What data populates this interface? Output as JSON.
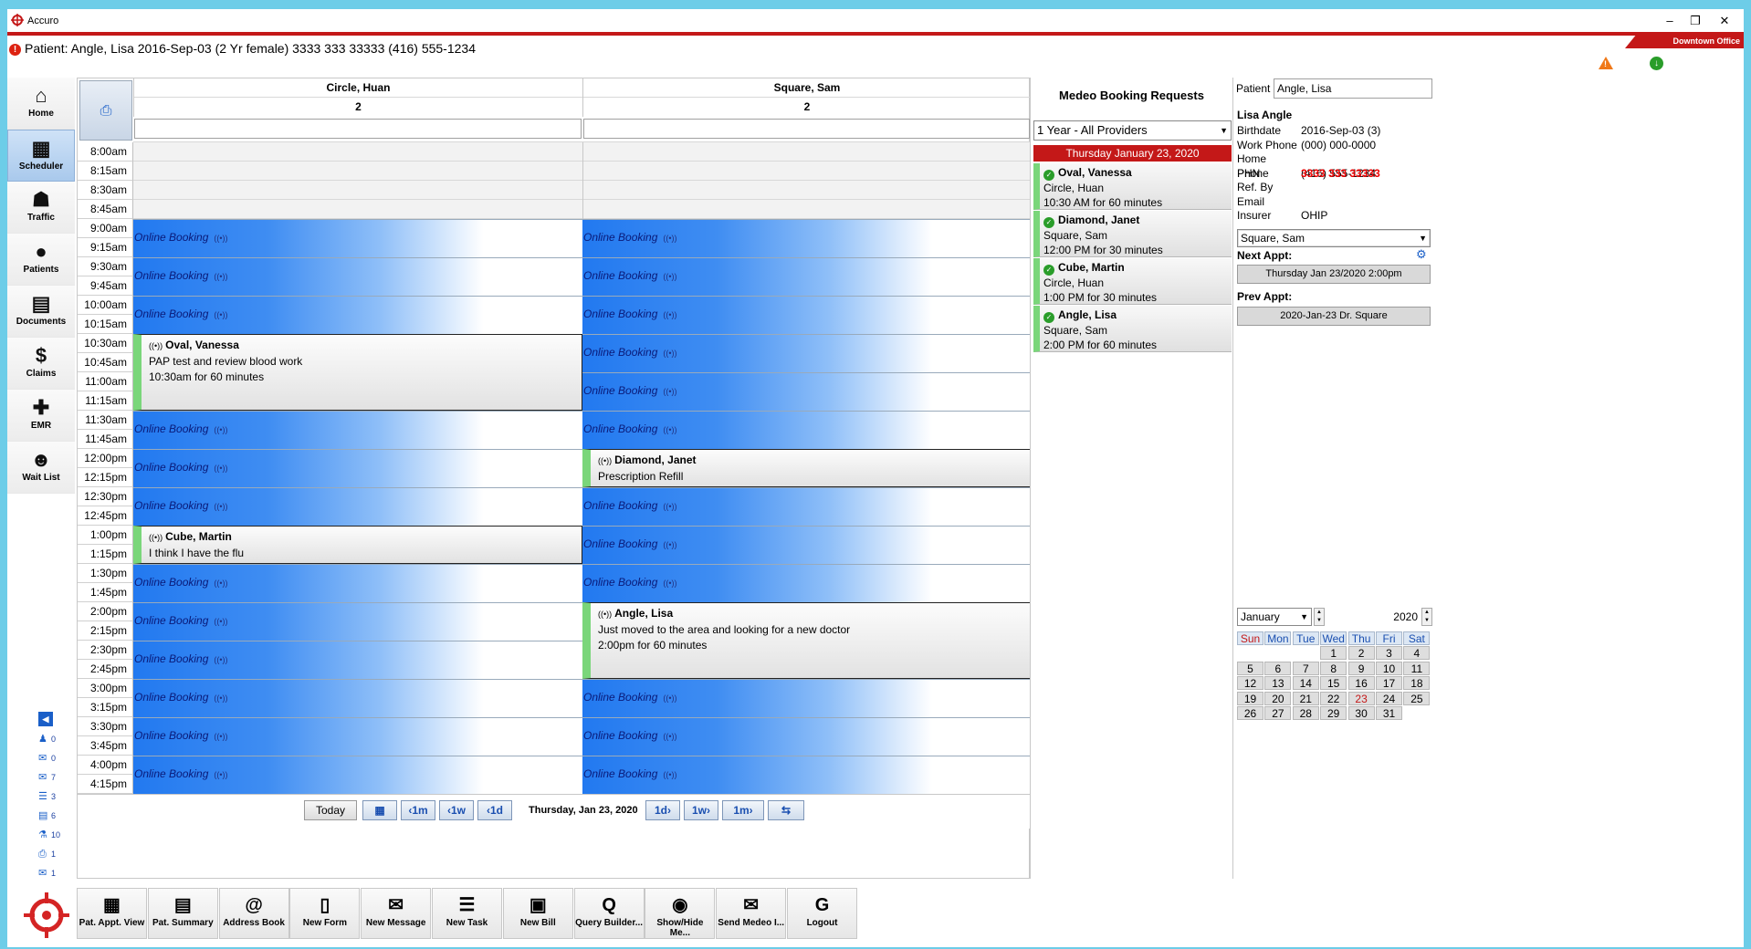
{
  "app": {
    "title": "Accuro",
    "office": "Downtown Office",
    "patient_banner": "Patient: Angle, Lisa 2016-Sep-03 (2 Yr female) 3333 333 33333 (416) 555-1234"
  },
  "nav": [
    {
      "label": "Home",
      "icon": "house-icon",
      "glyph": "⌂"
    },
    {
      "label": "Scheduler",
      "icon": "calendar-icon",
      "glyph": "▦",
      "active": true
    },
    {
      "label": "Traffic",
      "icon": "org-chart-icon",
      "glyph": "☗"
    },
    {
      "label": "Patients",
      "icon": "person-icon",
      "glyph": "●"
    },
    {
      "label": "Documents",
      "icon": "document-icon",
      "glyph": "▤"
    },
    {
      "label": "Claims",
      "icon": "dollar-icon",
      "glyph": "$"
    },
    {
      "label": "EMR",
      "icon": "medical-bag-icon",
      "glyph": "✚"
    },
    {
      "label": "Wait List",
      "icon": "people-icon",
      "glyph": "☻"
    }
  ],
  "counts": [
    {
      "icon": "user-icon",
      "glyph": "♟",
      "value": "0"
    },
    {
      "icon": "inbox-icon",
      "glyph": "✉",
      "value": "0"
    },
    {
      "icon": "mail-icon",
      "glyph": "✉",
      "value": "7"
    },
    {
      "icon": "list-icon",
      "glyph": "☰",
      "value": "3"
    },
    {
      "icon": "page-icon",
      "glyph": "▤",
      "value": "6"
    },
    {
      "icon": "lab-icon",
      "glyph": "⚗",
      "value": "10"
    },
    {
      "icon": "printer-icon",
      "glyph": "⎙",
      "value": "1"
    },
    {
      "icon": "fax-icon",
      "glyph": "✉",
      "value": "1"
    }
  ],
  "scheduler": {
    "columns": [
      {
        "name": "Circle, Huan",
        "count": "2"
      },
      {
        "name": "Square, Sam",
        "count": "2"
      }
    ],
    "times": [
      "8:00am",
      "8:15am",
      "8:30am",
      "8:45am",
      "9:00am",
      "9:15am",
      "9:30am",
      "9:45am",
      "10:00am",
      "10:15am",
      "10:30am",
      "10:45am",
      "11:00am",
      "11:15am",
      "11:30am",
      "11:45am",
      "12:00pm",
      "12:15pm",
      "12:30pm",
      "12:45pm",
      "1:00pm",
      "1:15pm",
      "1:30pm",
      "1:45pm",
      "2:00pm",
      "2:15pm",
      "2:30pm",
      "2:45pm",
      "3:00pm",
      "3:15pm",
      "3:30pm",
      "3:45pm",
      "4:00pm",
      "4:15pm"
    ],
    "online_label": "Online Booking",
    "online_slots": [
      {
        "col": 0,
        "row": 4
      },
      {
        "col": 0,
        "row": 6
      },
      {
        "col": 0,
        "row": 8
      },
      {
        "col": 0,
        "row": 14
      },
      {
        "col": 0,
        "row": 16
      },
      {
        "col": 0,
        "row": 18
      },
      {
        "col": 0,
        "row": 22
      },
      {
        "col": 0,
        "row": 24
      },
      {
        "col": 0,
        "row": 26
      },
      {
        "col": 0,
        "row": 28
      },
      {
        "col": 0,
        "row": 30
      },
      {
        "col": 0,
        "row": 32
      },
      {
        "col": 1,
        "row": 4
      },
      {
        "col": 1,
        "row": 6
      },
      {
        "col": 1,
        "row": 8
      },
      {
        "col": 1,
        "row": 10
      },
      {
        "col": 1,
        "row": 12
      },
      {
        "col": 1,
        "row": 14
      },
      {
        "col": 1,
        "row": 18
      },
      {
        "col": 1,
        "row": 20
      },
      {
        "col": 1,
        "row": 22
      },
      {
        "col": 1,
        "row": 28
      },
      {
        "col": 1,
        "row": 30
      },
      {
        "col": 1,
        "row": 32
      }
    ],
    "appointments": [
      {
        "col": 0,
        "row": 10,
        "rows": 4,
        "name": "Oval, Vanessa",
        "line1": "PAP test and review blood work",
        "line2": "10:30am for 60 minutes"
      },
      {
        "col": 1,
        "row": 16,
        "rows": 2,
        "name": "Diamond, Janet",
        "line1": "Prescription Refill",
        "line2": ""
      },
      {
        "col": 0,
        "row": 20,
        "rows": 2,
        "name": "Cube, Martin",
        "line1": "I think I have the flu",
        "line2": ""
      },
      {
        "col": 1,
        "row": 24,
        "rows": 4,
        "name": "Angle, Lisa",
        "line1": "Just moved to the area and looking for a new doctor",
        "line2": "2:00pm for 60 minutes"
      }
    ],
    "date_nav": {
      "today": "Today",
      "back_month": "‹1m",
      "back_week": "‹1w",
      "back_day": "‹1d",
      "current_date": "Thursday, Jan 23, 2020",
      "fwd_day": "1d›",
      "fwd_week": "1w›",
      "fwd_month": "1m›"
    }
  },
  "toolbar": [
    {
      "label": "Pat. Appt. View",
      "icon": "calendar-icon",
      "glyph": "▦"
    },
    {
      "label": "Pat. Summary",
      "icon": "clipboard-icon",
      "glyph": "▤"
    },
    {
      "label": "Address Book",
      "icon": "address-book-icon",
      "glyph": "@"
    },
    {
      "label": "New Form",
      "icon": "form-icon",
      "glyph": "▯"
    },
    {
      "label": "New Message",
      "icon": "envelope-icon",
      "glyph": "✉"
    },
    {
      "label": "New Task",
      "icon": "task-list-icon",
      "glyph": "☰"
    },
    {
      "label": "New Bill",
      "icon": "register-icon",
      "glyph": "▣"
    },
    {
      "label": "Query Builder...",
      "icon": "query-icon",
      "glyph": "Q"
    },
    {
      "label": "Show/Hide Me...",
      "icon": "eye-icon",
      "glyph": "◉"
    },
    {
      "label": "Send Medeo I...",
      "icon": "send-mail-icon",
      "glyph": "✉"
    },
    {
      "label": "Logout",
      "icon": "logout-icon",
      "glyph": "G"
    }
  ],
  "medeo": {
    "title": "Medeo Booking Requests",
    "filter": "1 Year - All Providers",
    "day": "Thursday January 23, 2020",
    "requests": [
      {
        "name": "Oval, Vanessa",
        "provider": "Circle, Huan",
        "when": "10:30 AM for 60 minutes"
      },
      {
        "name": "Diamond, Janet",
        "provider": "Square, Sam",
        "when": "12:00 PM for 30 minutes"
      },
      {
        "name": "Cube, Martin",
        "provider": "Circle, Huan",
        "when": "1:00 PM for 30 minutes"
      },
      {
        "name": "Angle, Lisa",
        "provider": "Square, Sam",
        "when": "2:00 PM for 60 minutes"
      }
    ]
  },
  "patient": {
    "label": "Patient",
    "value": "Angle, Lisa",
    "name": "Lisa Angle",
    "fields": [
      {
        "k": "Birthdate",
        "v": "2016-Sep-03 (3)",
        "red": false
      },
      {
        "k": "Work Phone",
        "v": "(000) 000-0000",
        "red": false
      },
      {
        "k": "Home Phone",
        "v": "(416) 555-1234",
        "red": false
      },
      {
        "k": "PHN",
        "v": "3333 333 33333",
        "red": true
      },
      {
        "k": "Ref. By",
        "v": "",
        "red": false
      },
      {
        "k": "Email",
        "v": "",
        "red": false
      },
      {
        "k": "Insurer",
        "v": "OHIP",
        "red": false
      }
    ],
    "provider": "Square, Sam",
    "next_label": "Next Appt:",
    "next_value": "Thursday Jan 23/2020 2:00pm",
    "prev_label": "Prev Appt:",
    "prev_value": "2020-Jan-23  Dr. Square"
  },
  "calendar": {
    "month": "January",
    "year": "2020",
    "days_hdr": [
      "Sun",
      "Mon",
      "Tue",
      "Wed",
      "Thu",
      "Fri",
      "Sat"
    ],
    "weeks": [
      [
        "",
        "",
        "",
        "1",
        "2",
        "3",
        "4"
      ],
      [
        "5",
        "6",
        "7",
        "8",
        "9",
        "10",
        "11"
      ],
      [
        "12",
        "13",
        "14",
        "15",
        "16",
        "17",
        "18"
      ],
      [
        "19",
        "20",
        "21",
        "22",
        "23",
        "24",
        "25"
      ],
      [
        "26",
        "27",
        "28",
        "29",
        "30",
        "31",
        ""
      ]
    ],
    "today": "23"
  }
}
